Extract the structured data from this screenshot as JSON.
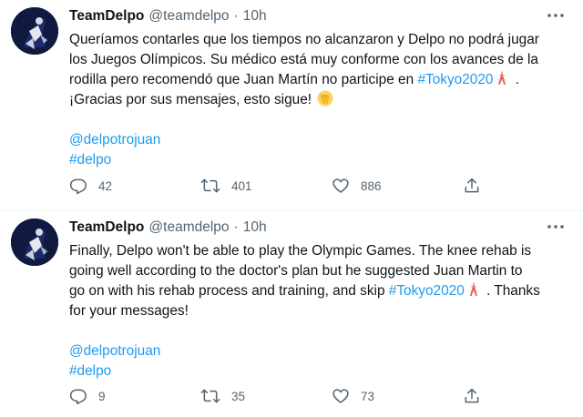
{
  "tweets": [
    {
      "author": {
        "display_name": "TeamDelpo",
        "handle": "@teamdelpo"
      },
      "separator": "·",
      "time": "10h",
      "lines": [
        {
          "text": "Queríamos contarles que los tiempos no alcanzaron y Delpo no podrá jugar"
        },
        {
          "text": "los Juegos Olímpicos. Su médico está muy conforme con los avances de la"
        },
        {
          "text_before": "rodilla pero recomendó que Juan Martín no participe en ",
          "hashtag": "#Tokyo2020",
          "text_after": " ."
        },
        {
          "text": "¡Gracias por sus mensajes, esto sigue!"
        }
      ],
      "mentions": [
        "@delpotrojuan",
        "#delpo"
      ],
      "stats": {
        "replies": "42",
        "retweets": "401",
        "likes": "886"
      },
      "icons": {
        "tower": "tokyo-tower-emoji-icon",
        "fist": "raised-fist-emoji-icon"
      }
    },
    {
      "author": {
        "display_name": "TeamDelpo",
        "handle": "@teamdelpo"
      },
      "separator": "·",
      "time": "10h",
      "lines": [
        {
          "text": "Finally, Delpo won't be able to play the Olympic Games. The knee rehab is"
        },
        {
          "text": "going well according to the doctor's plan but he suggested Juan Martin to"
        },
        {
          "text_before": "go on with his rehab process and training, and skip ",
          "hashtag": "#Tokyo2020",
          "text_after": " . Thanks"
        },
        {
          "text": "for your messages!"
        }
      ],
      "mentions": [
        "@delpotrojuan",
        "#delpo"
      ],
      "stats": {
        "replies": "9",
        "retweets": "35",
        "likes": "73"
      },
      "icons": {
        "tower": "tokyo-tower-emoji-icon"
      }
    }
  ],
  "colors": {
    "link": "#1d9bf0",
    "secondary_text": "#536471",
    "primary_text": "#0f1419",
    "divider": "#eff3f4"
  }
}
